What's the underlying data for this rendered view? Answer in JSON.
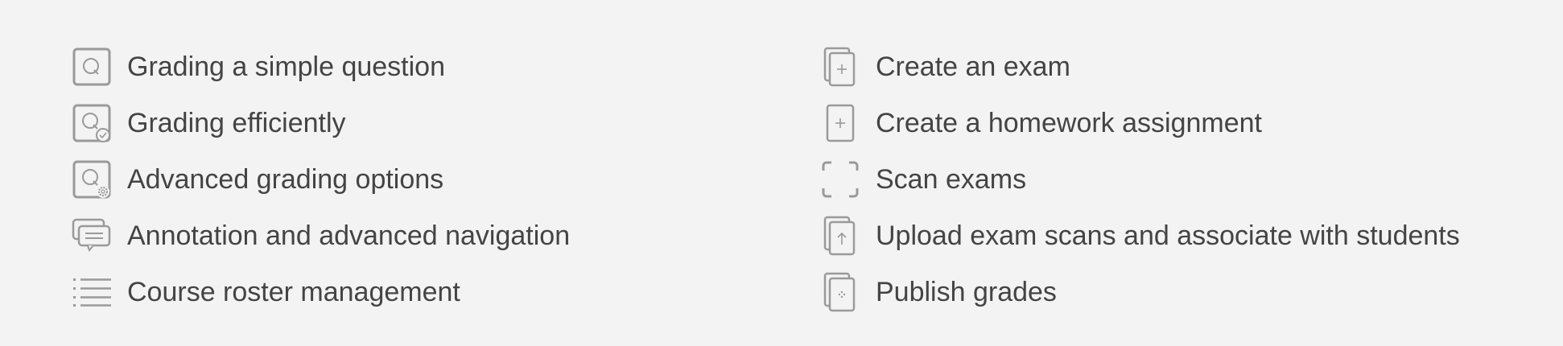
{
  "colors": {
    "background": "#f3f3f3",
    "text": "#444444",
    "icon": "#9a9a9a"
  },
  "left_list": [
    {
      "label": "Grading a simple question",
      "icon": "question-icon"
    },
    {
      "label": "Grading efficiently",
      "icon": "question-check-icon"
    },
    {
      "label": "Advanced grading options",
      "icon": "question-gear-icon"
    },
    {
      "label": "Annotation and advanced navigation",
      "icon": "comment-icon"
    },
    {
      "label": "Course roster management",
      "icon": "list-icon"
    }
  ],
  "right_list": [
    {
      "label": "Create an exam",
      "icon": "stacked-page-plus-icon"
    },
    {
      "label": "Create a homework assignment",
      "icon": "page-plus-icon"
    },
    {
      "label": "Scan exams",
      "icon": "scan-frame-icon"
    },
    {
      "label": "Upload exam scans and associate with students",
      "icon": "stacked-page-upload-icon"
    },
    {
      "label": "Publish grades",
      "icon": "stacked-page-dots-icon"
    }
  ]
}
